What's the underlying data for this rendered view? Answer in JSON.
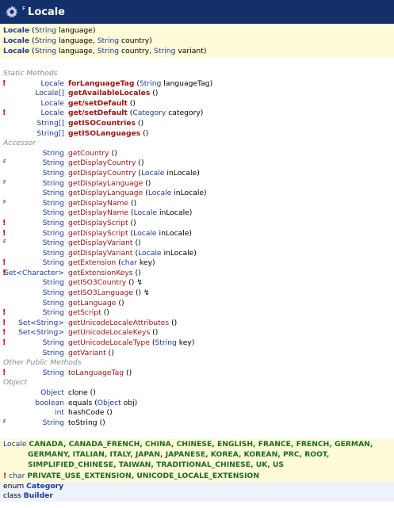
{
  "title": {
    "flag": "F",
    "text": "Locale",
    "icon": "gear-icon"
  },
  "constructors": [
    {
      "name": "Locale",
      "params": [
        {
          "type": "String",
          "name": "language"
        }
      ]
    },
    {
      "name": "Locale",
      "params": [
        {
          "type": "String",
          "name": "language"
        },
        {
          "type": "String",
          "name": "country"
        }
      ]
    },
    {
      "name": "Locale",
      "params": [
        {
          "type": "String",
          "name": "language"
        },
        {
          "type": "String",
          "name": "country"
        },
        {
          "type": "String",
          "name": "variant"
        }
      ]
    }
  ],
  "sections": {
    "static": "Static Methods",
    "accessor": "Accessor",
    "other": "Other Public Methods",
    "object": "Object"
  },
  "static_methods": [
    {
      "marker": "!",
      "ret": "Locale",
      "name": "forLanguageTag",
      "bold": true,
      "args": " (String languageTag)"
    },
    {
      "marker": "",
      "ret": "Locale[]",
      "name": "getAvailableLocales",
      "bold": true,
      "args": " ()"
    },
    {
      "marker": "",
      "ret": "Locale",
      "name": "get/setDefault",
      "bold": true,
      "args": " ()"
    },
    {
      "marker": "!",
      "ret": "Locale",
      "name": "get/setDefault",
      "bold": true,
      "args": " (Category category)"
    },
    {
      "marker": "",
      "ret": "String[]",
      "name": "getISOCountries",
      "bold": true,
      "args": " ()"
    },
    {
      "marker": "",
      "ret": "String[]",
      "name": "getISOLanguages",
      "bold": true,
      "args": " ()"
    }
  ],
  "accessor_methods": [
    {
      "marker": "",
      "ret": "String",
      "name": "getCountry",
      "args": " ()"
    },
    {
      "marker": "F",
      "ret": "String",
      "name": "getDisplayCountry",
      "args": " ()"
    },
    {
      "marker": "",
      "ret": "String",
      "name": "getDisplayCountry",
      "args": " (Locale inLocale)"
    },
    {
      "marker": "F",
      "ret": "String",
      "name": "getDisplayLanguage",
      "args": " ()"
    },
    {
      "marker": "",
      "ret": "String",
      "name": "getDisplayLanguage",
      "args": " (Locale inLocale)"
    },
    {
      "marker": "F",
      "ret": "String",
      "name": "getDisplayName",
      "args": " ()"
    },
    {
      "marker": "",
      "ret": "String",
      "name": "getDisplayName",
      "args": " (Locale inLocale)"
    },
    {
      "marker": "!",
      "ret": "String",
      "name": "getDisplayScript",
      "args": " ()"
    },
    {
      "marker": "!",
      "ret": "String",
      "name": "getDisplayScript",
      "args": " (Locale inLocale)"
    },
    {
      "marker": "F",
      "ret": "String",
      "name": "getDisplayVariant",
      "args": " ()"
    },
    {
      "marker": "",
      "ret": "String",
      "name": "getDisplayVariant",
      "args": " (Locale inLocale)"
    },
    {
      "marker": "!",
      "ret": "String",
      "name": "getExtension",
      "args": " (char key)"
    },
    {
      "marker": "!",
      "ret": "Set<Character>",
      "name": "getExtensionKeys",
      "args": " ()"
    },
    {
      "marker": "",
      "ret": "String",
      "name": "getISO3Country",
      "args": " () ↯"
    },
    {
      "marker": "",
      "ret": "String",
      "name": "getISO3Language",
      "args": " () ↯"
    },
    {
      "marker": "",
      "ret": "String",
      "name": "getLanguage",
      "args": " ()"
    },
    {
      "marker": "!",
      "ret": "String",
      "name": "getScript",
      "args": " ()"
    },
    {
      "marker": "!",
      "ret": "Set<String>",
      "name": "getUnicodeLocaleAttributes",
      "args": " ()"
    },
    {
      "marker": "!",
      "ret": "Set<String>",
      "name": "getUnicodeLocaleKeys",
      "args": " ()"
    },
    {
      "marker": "!",
      "ret": "String",
      "name": "getUnicodeLocaleType",
      "args": " (String key)"
    },
    {
      "marker": "",
      "ret": "String",
      "name": "getVariant",
      "args": " ()"
    }
  ],
  "other_methods": [
    {
      "marker": "!",
      "ret": "String",
      "name": "toLanguageTag",
      "args": " ()"
    }
  ],
  "object_methods": [
    {
      "marker": "",
      "ret": "Object",
      "name": "clone",
      "args": " ()"
    },
    {
      "marker": "",
      "ret": "boolean",
      "name": "equals",
      "args": " (Object obj)"
    },
    {
      "marker": "",
      "ret": "int",
      "name": "hashCode",
      "args": " ()"
    },
    {
      "marker": "F",
      "ret": "String",
      "name": "toString",
      "args": " ()"
    }
  ],
  "constants": {
    "type": "Locale",
    "line1": "CANADA, CANADA_FRENCH, CHINA, CHINESE, ENGLISH, FRANCE, FRENCH, GERMAN,",
    "line2": "GERMANY, ITALIAN, ITALY, JAPAN, JAPANESE, KOREA, KOREAN, PRC, ROOT,",
    "line3": "SIMPLIFIED_CHINESE, TAIWAN, TRADITIONAL_CHINESE, UK, US"
  },
  "char_constants": {
    "marker": "!",
    "type": "char",
    "values": "PRIVATE_USE_EXTENSION, UNICODE_LOCALE_EXTENSION"
  },
  "nested": [
    {
      "kind": "enum",
      "name": "Category"
    },
    {
      "kind": "class",
      "name": "Builder"
    }
  ]
}
